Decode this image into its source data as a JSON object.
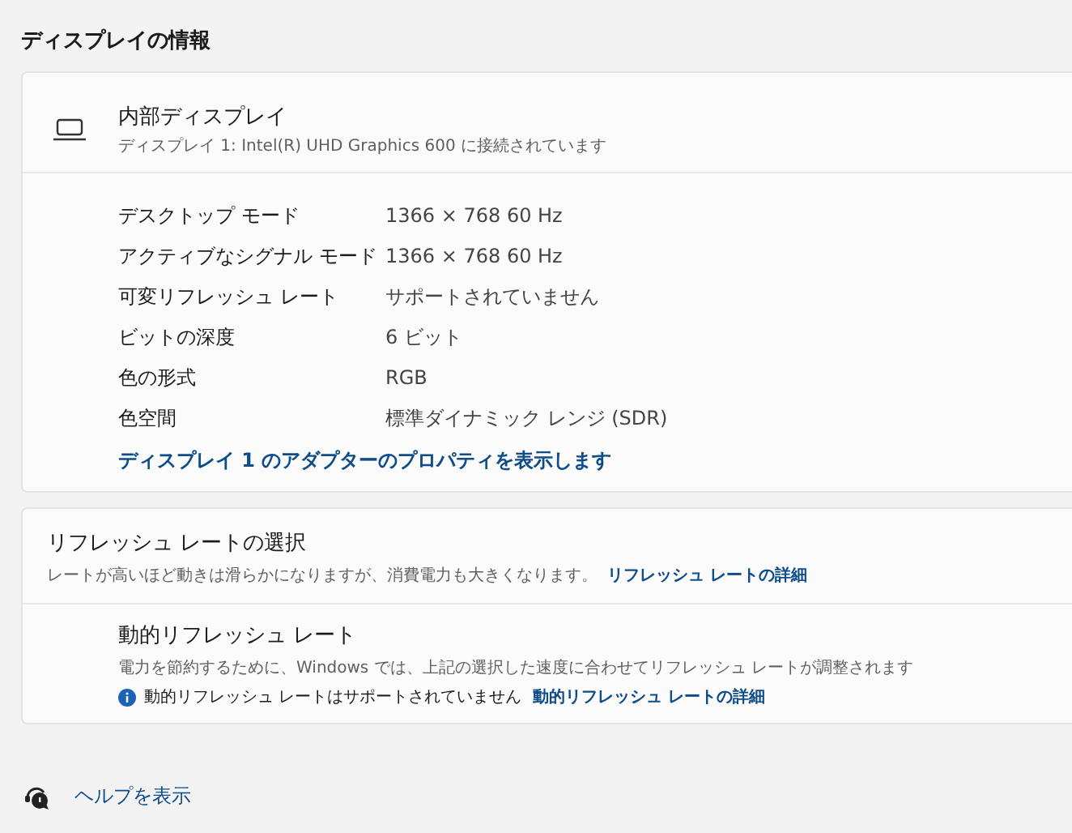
{
  "title": "ディスプレイの情報",
  "display": {
    "name": "内部ディスプレイ",
    "subtitle": "ディスプレイ 1: Intel(R) UHD Graphics 600 に接続されています",
    "properties": [
      {
        "label": "デスクトップ モード",
        "value": "1366 × 768 60 Hz"
      },
      {
        "label": "アクティブなシグナル モード",
        "value": "1366 × 768 60 Hz"
      },
      {
        "label": "可変リフレッシュ レート",
        "value": "サポートされていません"
      },
      {
        "label": "ビットの深度",
        "value": "6 ビット"
      },
      {
        "label": "色の形式",
        "value": "RGB"
      },
      {
        "label": "色空間",
        "value": "標準ダイナミック レンジ (SDR)"
      }
    ],
    "adapter_link": "ディスプレイ 1 のアダプターのプロパティを表示します"
  },
  "refresh": {
    "title": "リフレッシュ レートの選択",
    "description": "レートが高いほど動きは滑らかになりますが、消費電力も大きくなります。",
    "link": "リフレッシュ レートの詳細"
  },
  "dynamic": {
    "title": "動的リフレッシュ レート",
    "description": "電力を節約するために、Windows では、上記の選択した速度に合わせてリフレッシュ レートが調整されます",
    "notice": "動的リフレッシュ レートはサポートされていません",
    "link": "動的リフレッシュ レートの詳細"
  },
  "help": {
    "label": "ヘルプを表示"
  }
}
